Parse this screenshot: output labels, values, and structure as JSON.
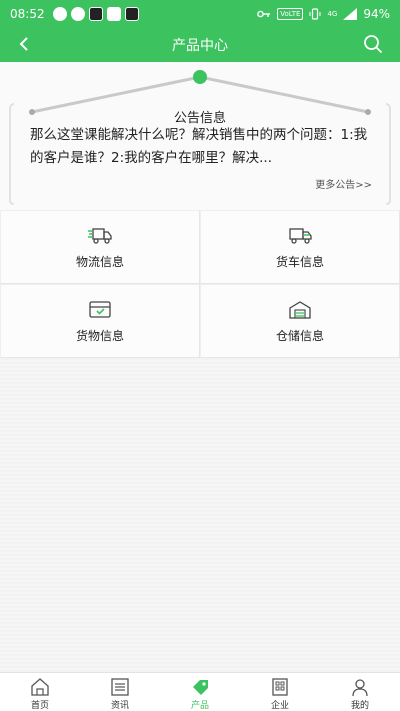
{
  "status_bar": {
    "time": "08:52",
    "network": "VoLTE",
    "signal_label": "4G",
    "battery": "94%"
  },
  "nav": {
    "title": "产品中心"
  },
  "notice": {
    "title": "公告信息",
    "body": "那么这堂课能解决什么呢？解决销售中的两个问题：1:我的客户是谁？2:我的客户在哪里？解决...",
    "more": "更多公告>>"
  },
  "grid": {
    "items": [
      {
        "label": "物流信息",
        "icon": "truck-fast-icon"
      },
      {
        "label": "货车信息",
        "icon": "truck-icon"
      },
      {
        "label": "货物信息",
        "icon": "cargo-box-icon"
      },
      {
        "label": "仓储信息",
        "icon": "warehouse-icon"
      }
    ]
  },
  "tabbar": {
    "tabs": [
      {
        "label": "首页",
        "icon": "home-icon"
      },
      {
        "label": "资讯",
        "icon": "news-icon"
      },
      {
        "label": "产品",
        "icon": "tag-icon",
        "active": true
      },
      {
        "label": "企业",
        "icon": "building-icon"
      },
      {
        "label": "我的",
        "icon": "user-icon"
      }
    ]
  },
  "colors": {
    "brand": "#3cc35f"
  }
}
